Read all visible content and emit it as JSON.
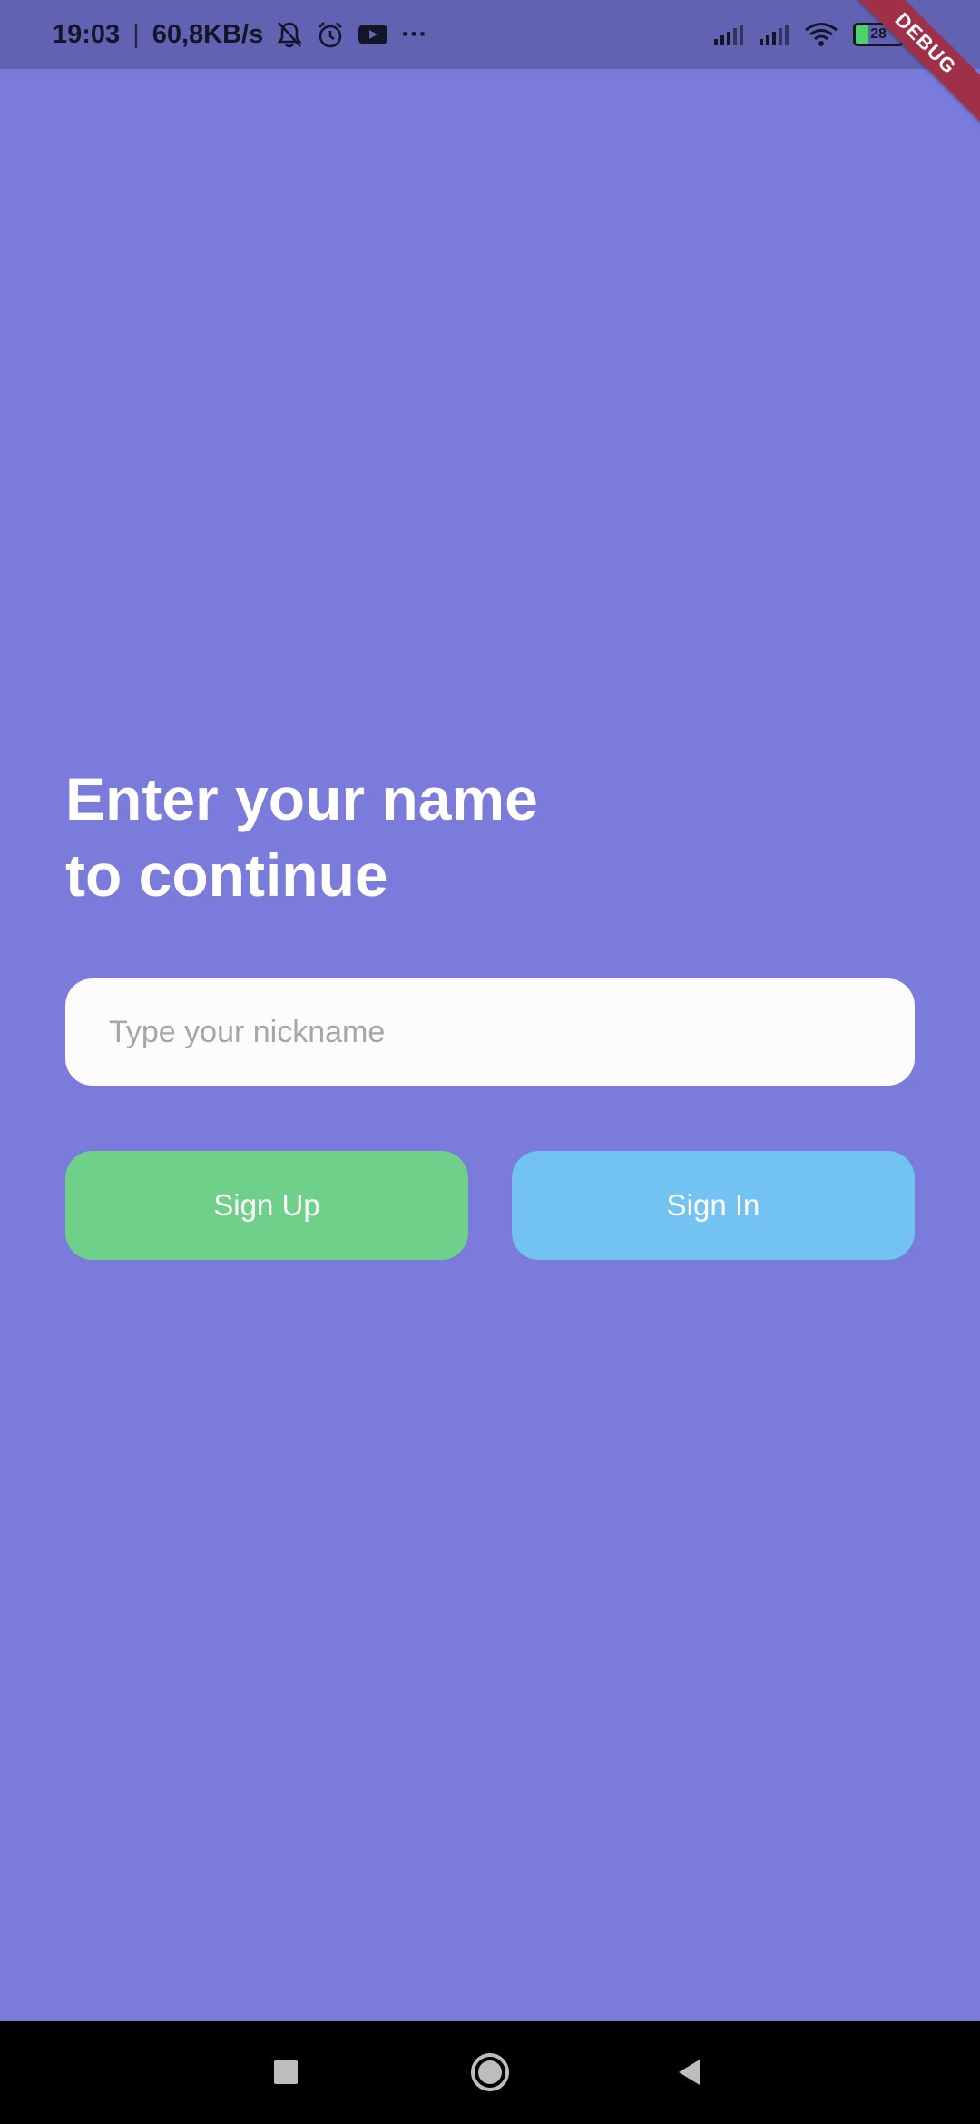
{
  "status_bar": {
    "time": "19:03",
    "separator": "|",
    "network_speed": "60,8KB/s",
    "overflow": "···",
    "battery_level": "28",
    "icons_left": [
      "bell-off-icon",
      "alarm-icon",
      "youtube-icon"
    ],
    "icons_right": [
      "signal-icon",
      "signal-icon",
      "wifi-icon",
      "battery-icon",
      "charging-icon"
    ]
  },
  "debug_banner": {
    "label": "DEBUG"
  },
  "main": {
    "headline_line1": "Enter your name",
    "headline_line2": "to continue",
    "nickname_placeholder": "Type your nickname",
    "nickname_value": "",
    "sign_up_label": "Sign Up",
    "sign_in_label": "Sign In"
  },
  "nav_bar": {
    "buttons": [
      "recents-icon",
      "home-icon",
      "back-icon"
    ]
  },
  "colors": {
    "background": "#7a7bdb",
    "status_bar": "#6162b1",
    "input_bg": "#fcfcfa",
    "sign_up": "#6fd08a",
    "sign_in": "#72c3f1",
    "debug_banner": "#a03048",
    "nav_bar": "#000000"
  }
}
